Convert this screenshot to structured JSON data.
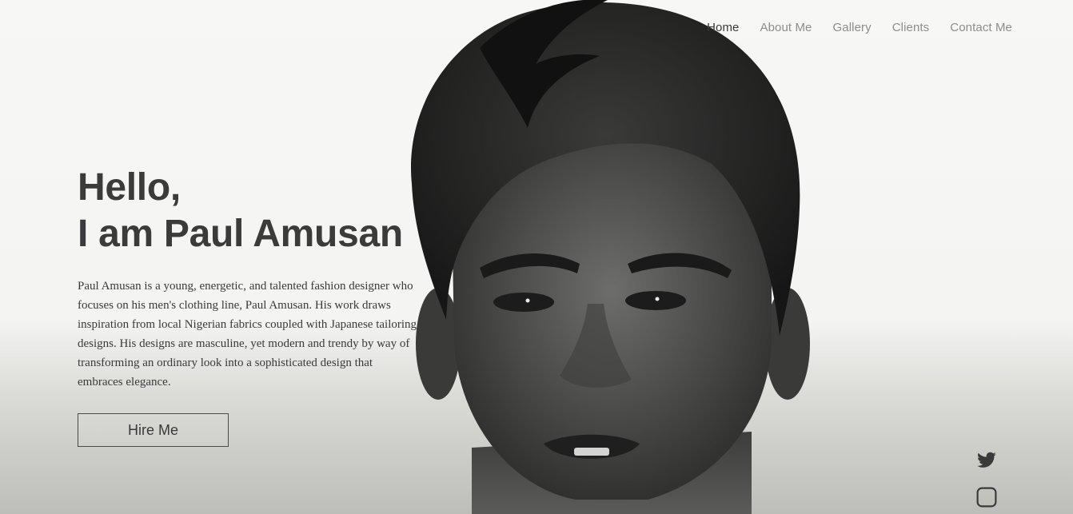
{
  "nav": {
    "items": [
      {
        "label": "Home",
        "active": true
      },
      {
        "label": "About Me",
        "active": false
      },
      {
        "label": "Gallery",
        "active": false
      },
      {
        "label": "Clients",
        "active": false
      },
      {
        "label": "Contact Me",
        "active": false
      }
    ]
  },
  "hero": {
    "greeting": "Hello,",
    "name_line": "I am Paul Amusan",
    "bio": "Paul Amusan is a young, energetic, and talented fashion designer who focuses on his men's clothing line, Paul Amusan. His work draws inspiration from local Nigerian fabrics coupled with Japanese tailoring designs. His designs are masculine, yet modern and trendy by way of transforming an ordinary look into a sophisticated design that embraces elegance.",
    "cta_label": "Hire Me",
    "background_image": "black-and-white-portrait-photo"
  },
  "social": {
    "icons": [
      "twitter-icon",
      "instagram-icon"
    ]
  },
  "colors": {
    "text_dark": "#3a3a3a",
    "nav_inactive": "#8d8d8d",
    "background": "#f6f6f4"
  }
}
